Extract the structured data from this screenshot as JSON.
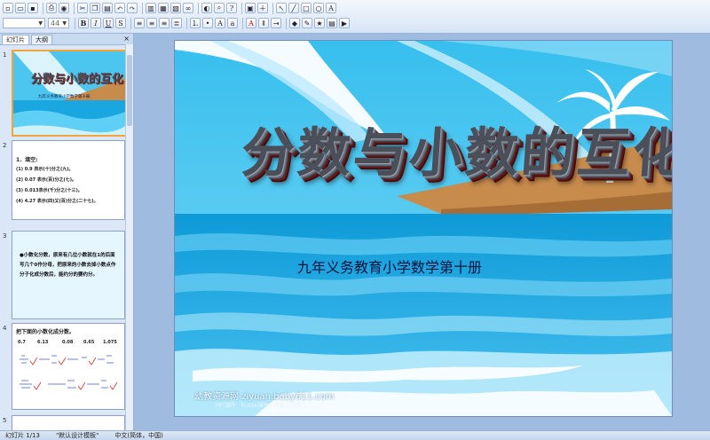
{
  "toolbar": {
    "font_name": "",
    "font_size": "44",
    "bold": "B",
    "italic": "I",
    "underline": "U",
    "shadow": "S",
    "font_color": "A"
  },
  "panel_tabs": {
    "slides": "幻灯片",
    "outline": "大纲",
    "close": "×"
  },
  "thumbnails": {
    "s1": {
      "num": "1",
      "title": "分数与小数的互化",
      "subtitle": "九年义务教育小学数学第十册"
    },
    "s2": {
      "num": "2",
      "heading": "1．填空:",
      "lines": [
        "(1) 0.9  表示(十)分之(九)。",
        "(2) 0.07 表示(百)分之(七)。",
        "(3) 0.013表示(千)分之(十三)。",
        "(4) 4.27 表示(四)又(百)分之(二十七)。"
      ]
    },
    "s3": {
      "num": "3",
      "text": "●小数化分数，原来有几位小数就在1的后面写几个0作分母，把原来的小数去掉小数点作分子化成分数后，能约分的要约分。"
    },
    "s4": {
      "num": "4",
      "heading": "把下面的小数化成分数。",
      "values": [
        "0.7",
        "6.13",
        "0.08",
        "0.65",
        "1.075"
      ]
    },
    "s5": {
      "num": "5"
    }
  },
  "slide": {
    "title": "分数与小数的互化",
    "subtitle": "九年义务教育小学数学第十册",
    "watermark": "幼教资源网 ziyuan.baby611.com",
    "watermark_sub": "PPT课件 · FLASH课件 · 教案 · 试卷"
  },
  "status": {
    "slide_pos": "幻灯片 1/13",
    "template": "\"默认设计模板\"",
    "language": "中文(简体，中国)"
  },
  "colors": {
    "sky": "#4cc6ee",
    "sea": "#1aa7e0",
    "beach": "#c78b4c",
    "title_red": "#6e1717",
    "subtitle": "#0c1440",
    "selection": "#f0a53c"
  }
}
